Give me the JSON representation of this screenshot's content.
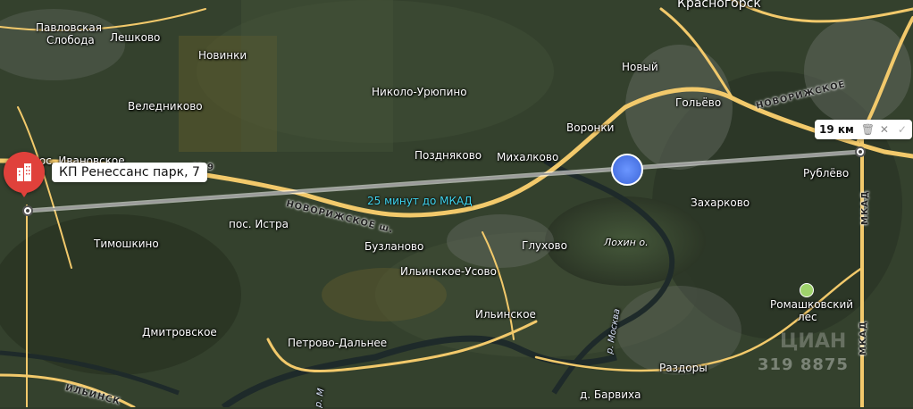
{
  "map": {
    "places": [
      {
        "id": "krasnogorsk",
        "text": "Красногорск"
      },
      {
        "id": "pavlovskaya",
        "text": "Павловская"
      },
      {
        "id": "sloboda",
        "text": "Слобода"
      },
      {
        "id": "leshkovo",
        "text": "Лешково"
      },
      {
        "id": "novinki",
        "text": "Новинки"
      },
      {
        "id": "novy",
        "text": "Новый"
      },
      {
        "id": "velednikovo",
        "text": "Веледниково"
      },
      {
        "id": "nikolo",
        "text": "Николо-Урюпино"
      },
      {
        "id": "golevo",
        "text": "Гольёво"
      },
      {
        "id": "voronki",
        "text": "Воронки"
      },
      {
        "id": "ivanovskoe",
        "text": "пос. Ивановское"
      },
      {
        "id": "pozdnyakovo",
        "text": "Поздняково"
      },
      {
        "id": "mikhalkovo",
        "text": "Михалково"
      },
      {
        "id": "rublevo",
        "text": "Рублёво"
      },
      {
        "id": "zakharkovo",
        "text": "Захарково"
      },
      {
        "id": "istra",
        "text": "пос. Истра"
      },
      {
        "id": "timoshkino",
        "text": "Тимошкино"
      },
      {
        "id": "buzlanovo",
        "text": "Бузланово"
      },
      {
        "id": "glukhovo",
        "text": "Глухово"
      },
      {
        "id": "ilinskoe_usovo",
        "text": "Ильинское-Усово"
      },
      {
        "id": "dmitrovskoe",
        "text": "Дмитровское"
      },
      {
        "id": "ilinskoe",
        "text": "Ильинское"
      },
      {
        "id": "petrovo",
        "text": "Петрово-Дальнее"
      },
      {
        "id": "romashkovsky1",
        "text": "Ромашковский"
      },
      {
        "id": "romashkovsky2",
        "text": "лес"
      },
      {
        "id": "razdory",
        "text": "Раздоры"
      },
      {
        "id": "barviha",
        "text": "д. Барвиха"
      }
    ],
    "water": {
      "lokhin": "Лохин о.",
      "moskva_river": "р. Москва",
      "river_m": "р. М"
    },
    "roads": {
      "novorizhskoe": "НОВОРИЖСКОЕ ш.",
      "novorizhskoe_ne": "НОВОРИЖСКОЕ",
      "mkad": "МКАД",
      "ilinskoe_sh": "ИЛЬИНСК",
      "m9": "М-9",
      "ne_fragment": "Не"
    },
    "route_label": "25 минут до МКАД",
    "pin_label": "КП Ренессанс парк, 7",
    "distance": {
      "text": "19 км",
      "delete_icon": "trash-icon",
      "close_icon": "close-icon",
      "confirm_icon": "check-icon"
    },
    "watermark": {
      "line1": "ЦИАН",
      "line2": "319 8875"
    }
  },
  "colors": {
    "pin": "#e0413b",
    "road": "#f2c96b",
    "route": "#c9c9c9",
    "route_text": "#3fd3ee",
    "highlight": "#4a74e8"
  }
}
